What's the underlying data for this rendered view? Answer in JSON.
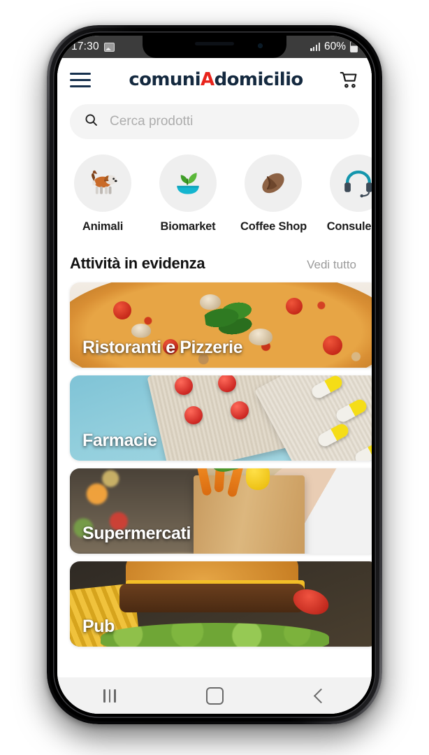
{
  "status_bar": {
    "time": "17:30",
    "photo_icon": "photo-icon",
    "signal_icon": "signal-bars-icon",
    "battery_percent": "60%",
    "battery_icon": "battery-icon"
  },
  "header": {
    "menu_icon": "hamburger-menu-icon",
    "logo_part1": "comuni",
    "logo_accent": "A",
    "logo_part2": "domicilio",
    "logo_color_dark": "#14293f",
    "logo_color_accent": "#e8241c",
    "cart_icon": "shopping-cart-icon"
  },
  "search": {
    "icon": "search-icon",
    "placeholder": "Cerca prodotti",
    "value": ""
  },
  "categories": [
    {
      "label": "Animali",
      "icon": "dog-icon"
    },
    {
      "label": "Biomarket",
      "icon": "seedling-bowl-icon"
    },
    {
      "label": "Coffee Shop",
      "icon": "coffee-bean-icon"
    },
    {
      "label": "Consulenza",
      "icon": "headset-icon"
    }
  ],
  "section": {
    "title": "Attività in evidenza",
    "see_all": "Vedi tutto"
  },
  "cards": [
    {
      "title": "Ristoranti e Pizzerie",
      "art": "pizza"
    },
    {
      "title": "Farmacie",
      "art": "pharmacy"
    },
    {
      "title": "Supermercati",
      "art": "supermarket"
    },
    {
      "title": "Pub",
      "art": "burger"
    }
  ],
  "nav_bar": {
    "recents_icon": "recents-icon",
    "home_icon": "home-icon",
    "back_icon": "back-icon"
  }
}
